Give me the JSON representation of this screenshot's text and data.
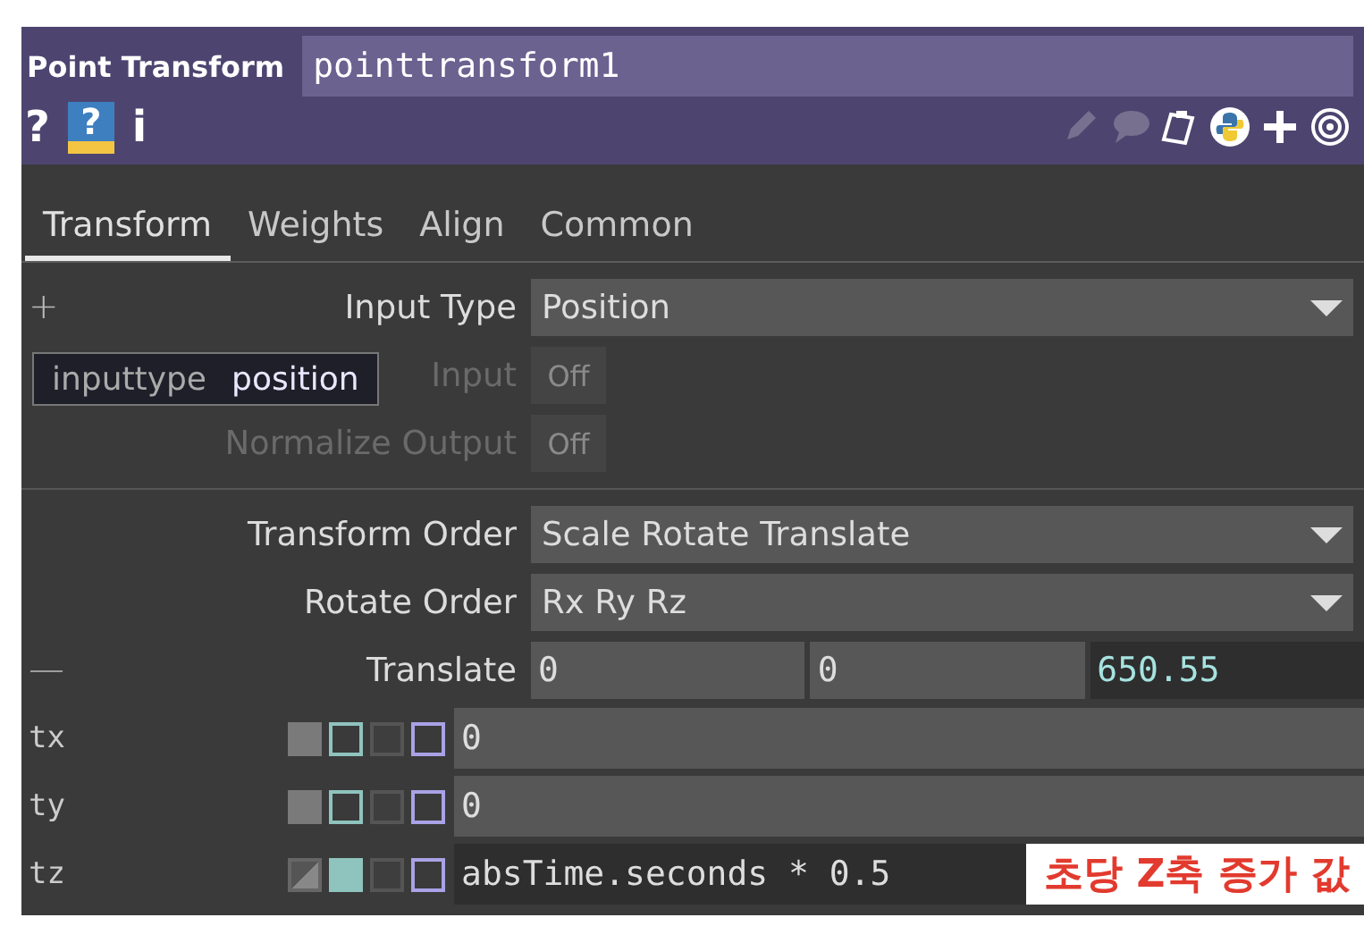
{
  "header": {
    "type_label": "Point Transform",
    "node_name": "pointtransform1"
  },
  "toolbar_left": [
    {
      "glyph": "?",
      "kind": "plain"
    },
    {
      "glyph": "?",
      "kind": "badge"
    },
    {
      "glyph": "i",
      "kind": "plain"
    }
  ],
  "toolbar_right": [
    {
      "kind": "pencil",
      "disabled": true
    },
    {
      "kind": "comment",
      "disabled": true
    },
    {
      "kind": "clipboard",
      "disabled": false
    },
    {
      "kind": "python",
      "disabled": false
    },
    {
      "kind": "plus",
      "disabled": false
    },
    {
      "kind": "target",
      "disabled": false
    }
  ],
  "tabs": [
    {
      "label": "Transform",
      "selected": true
    },
    {
      "label": "Weights",
      "selected": false
    },
    {
      "label": "Align",
      "selected": false
    },
    {
      "label": "Common",
      "selected": false
    }
  ],
  "params": [
    {
      "kind": "menu",
      "toggle_glyph": "+",
      "label": "Input Type",
      "value": "Position"
    },
    {
      "kind": "toggle",
      "label": "Input",
      "value": "Off",
      "disabled": true,
      "tooltip": {
        "name": "inputtype",
        "value": "position"
      }
    },
    {
      "kind": "toggle",
      "label": "Normalize Output",
      "value": "Off",
      "disabled": true
    },
    {
      "kind": "separator"
    },
    {
      "kind": "menu",
      "label": "Transform Order",
      "value": "Scale Rotate Translate"
    },
    {
      "kind": "menu",
      "label": "Rotate Order",
      "value": "Rx Ry Rz"
    },
    {
      "kind": "vector",
      "toggle_glyph": "—",
      "label": "Translate",
      "values": [
        {
          "text": "0",
          "expression": false
        },
        {
          "text": "0",
          "expression": false
        },
        {
          "text": "650.55",
          "expression": true
        }
      ]
    },
    {
      "kind": "sub",
      "label": "tx",
      "value": "0",
      "expression": false,
      "modes": [
        {
          "kind": "constant",
          "selected": true
        },
        {
          "kind": "expression",
          "selected": false
        },
        {
          "kind": "export",
          "selected": false
        },
        {
          "kind": "bind",
          "selected": false
        }
      ]
    },
    {
      "kind": "sub",
      "label": "ty",
      "value": "0",
      "expression": false,
      "modes": [
        {
          "kind": "constant",
          "selected": true
        },
        {
          "kind": "expression",
          "selected": false
        },
        {
          "kind": "export",
          "selected": false
        },
        {
          "kind": "bind",
          "selected": false
        }
      ]
    },
    {
      "kind": "sub",
      "label": "tz",
      "value": "absTime.seconds * 0.5",
      "expression": true,
      "modes": [
        {
          "kind": "constant",
          "selected": false
        },
        {
          "kind": "expression",
          "selected": true
        },
        {
          "kind": "export",
          "selected": false
        },
        {
          "kind": "bind",
          "selected": false
        }
      ]
    }
  ],
  "annotation": "초당 Z축 증가 값"
}
